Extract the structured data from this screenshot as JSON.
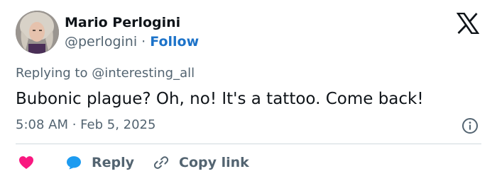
{
  "author": {
    "name": "Mario Perlogini",
    "handle": "@perlogini",
    "separator": " · ",
    "follow_label": "Follow"
  },
  "replying": {
    "prefix": "Replying to ",
    "mention": "@interesting_all"
  },
  "tweet": {
    "text": "Bubonic plague? Oh, no! It's a tattoo. Come back!",
    "timestamp": "5:08 AM · Feb 5, 2025"
  },
  "actions": {
    "reply_label": "Reply",
    "copy_label": "Copy link"
  },
  "icons": {
    "brand": "x-logo-icon",
    "info": "info-icon",
    "like": "heart-icon",
    "reply": "speech-bubble-icon",
    "copy": "link-icon"
  },
  "colors": {
    "text": "#0f1419",
    "secondary": "#536471",
    "link": "#1d73c9",
    "heart": "#f91880",
    "reply_bubble": "#1d9bf0",
    "divider": "#cfd9de"
  }
}
